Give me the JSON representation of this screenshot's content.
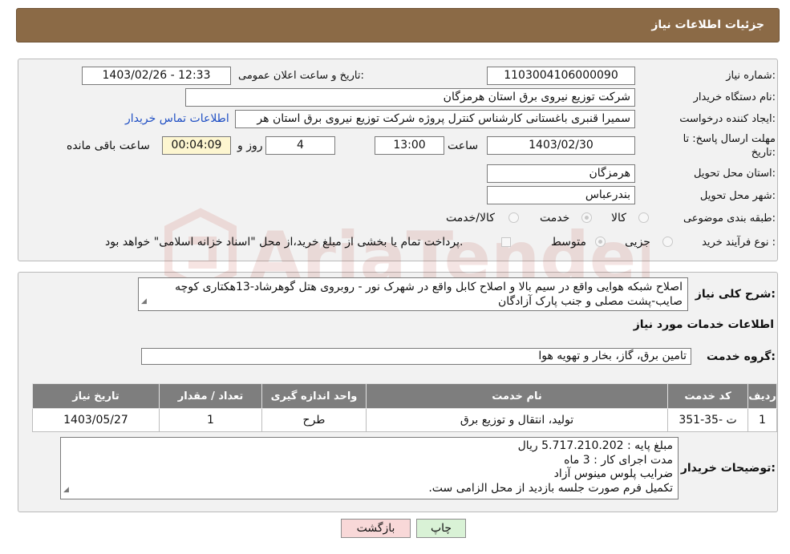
{
  "header": {
    "title": "جزئیات اطلاعات نیاز"
  },
  "fields": {
    "need_number_label": "شماره نیاز:",
    "need_number": "1103004106000090",
    "announce_label": "تاریخ و ساعت اعلان عمومی:",
    "announce_value": "1403/02/26 - 12:33",
    "buyer_org_label": "نام دستگاه خریدار:",
    "buyer_org": "شرکت توزیع نیروی برق استان هرمزگان",
    "creator_label": "ایجاد کننده درخواست:",
    "creator": "سمیرا قنبری باغستانی کارشناس کنترل پروژه شرکت توزیع نیروی برق استان هر",
    "buyer_contact_link": "اطلاعات تماس خریدار",
    "deadline_label_1": "مهلت ارسال پاسخ: تا",
    "deadline_label_2": "تاریخ:",
    "deadline_date": "1403/02/30",
    "time_label": "ساعت",
    "deadline_time": "13:00",
    "days_value": "4",
    "days_label": "روز و",
    "remaining_time": "00:04:09",
    "remaining_label": "ساعت باقی مانده",
    "province_label": "استان محل تحویل:",
    "province": "هرمزگان",
    "city_label": "شهر محل تحویل:",
    "city": "بندرعباس",
    "category_label": "طبقه بندی موضوعی:",
    "category_options": [
      "کالا",
      "خدمت",
      "کالا/خدمت"
    ],
    "process_label": "نوع فرآیند خرید :",
    "process_options": [
      "جزیی",
      "متوسط"
    ],
    "payment_note": "پرداخت تمام یا بخشی از مبلغ خرید،از محل \"اسناد خزانه اسلامی\" خواهد بود."
  },
  "description": {
    "label": "شرح کلی نیاز:",
    "text": "اصلاح شبکه هوایی واقع در سیم بالا و اصلاح کابل واقع در شهرک نور - روبروی هتل گوهرشاد-13هکتاری کوچه صایب-پشت مصلی و جنب پارک آزادگان"
  },
  "services": {
    "section_title": "اطلاعات خدمات مورد نیاز",
    "group_label": "گروه خدمت:",
    "group_value": "تامین برق، گاز، بخار و تهویه هوا",
    "columns": [
      "ردیف",
      "کد خدمت",
      "نام خدمت",
      "واحد اندازه گیری",
      "تعداد / مقدار",
      "تاریخ نیاز"
    ],
    "rows": [
      [
        "1",
        "ت -35-351",
        "تولید، انتقال و توزیع برق",
        "طرح",
        "1",
        "1403/05/27"
      ]
    ]
  },
  "buyer_notes": {
    "label": "توضیحات خریدار:",
    "lines": [
      "مبلغ پایه : 5.717.210.202 ریال",
      "مدت اجرای کار : 3 ماه",
      "ضرایب پلوس مینوس آزاد",
      "تکمیل فرم صورت جلسه بازدید از محل الزامی ست."
    ]
  },
  "buttons": {
    "print": "چاپ",
    "back": "بازگشت"
  },
  "watermark": {
    "text": "AriaTender.neT"
  },
  "colors": {
    "header_bg": "#8b6a46",
    "link": "#1f4fc4",
    "table_header": "#7e7e7e",
    "print_btn": "#d9f2d6",
    "back_btn": "#f8d8d8"
  }
}
